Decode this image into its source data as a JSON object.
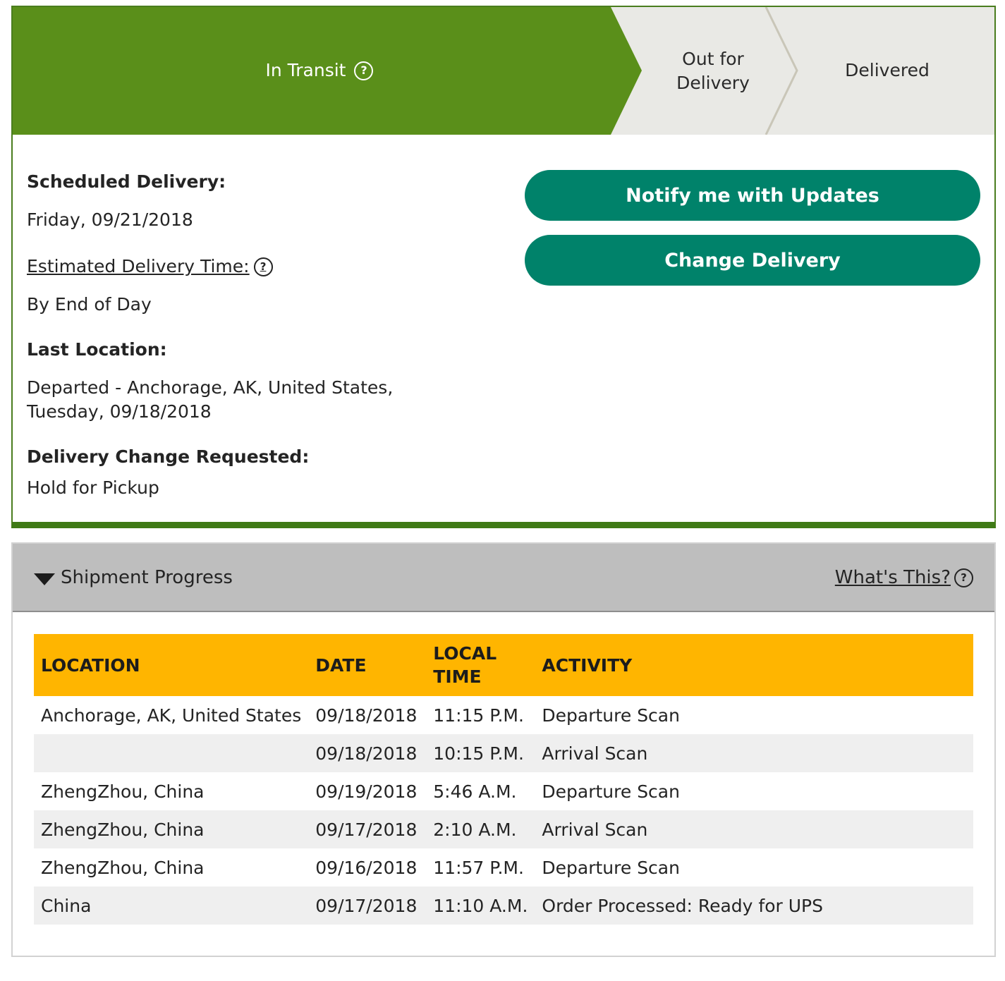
{
  "progress": {
    "steps": [
      {
        "label": "In Transit",
        "active": true
      },
      {
        "label": "Out for Delivery",
        "active": false
      },
      {
        "label": "Delivered",
        "active": false
      }
    ],
    "colors": {
      "active": "#5a8f1a",
      "inactive": "#e9e9e5"
    }
  },
  "details": {
    "scheduled_label": "Scheduled Delivery:",
    "scheduled_value": "Friday, 09/21/2018",
    "estimated_label": "Estimated Delivery Time:",
    "estimated_value": "By End of Day",
    "last_location_label": "Last Location:",
    "last_location_line1": "Departed - Anchorage, AK, United States,",
    "last_location_line2": "Tuesday, 09/18/2018",
    "change_label": "Delivery Change Requested:",
    "change_value": "Hold for Pickup"
  },
  "buttons": {
    "notify": "Notify me with Updates",
    "change": "Change Delivery",
    "color": "#00826a"
  },
  "shipment_progress": {
    "title": "Shipment Progress",
    "whats_this": "What's This?",
    "headers": [
      "LOCATION",
      "DATE",
      "LOCAL TIME",
      "ACTIVITY"
    ],
    "header_color": "#ffb500",
    "rows": [
      {
        "location": "Anchorage,  AK,  United States",
        "date": "09/18/2018",
        "time": "11:15 P.M.",
        "activity": "Departure Scan"
      },
      {
        "location": "",
        "date": "09/18/2018",
        "time": "10:15 P.M.",
        "activity": "Arrival Scan"
      },
      {
        "location": "ZhengZhou,  China",
        "date": "09/19/2018",
        "time": "5:46 A.M.",
        "activity": "Departure Scan"
      },
      {
        "location": "ZhengZhou,  China",
        "date": "09/17/2018",
        "time": "2:10 A.M.",
        "activity": "Arrival Scan"
      },
      {
        "location": "ZhengZhou,  China",
        "date": "09/16/2018",
        "time": "11:57 P.M.",
        "activity": "Departure Scan"
      },
      {
        "location": "China",
        "date": "09/17/2018",
        "time": "11:10 A.M.",
        "activity": "Order Processed: Ready for UPS"
      }
    ]
  },
  "icons": {
    "help": "question-circle-icon",
    "caret": "caret-down-icon"
  }
}
